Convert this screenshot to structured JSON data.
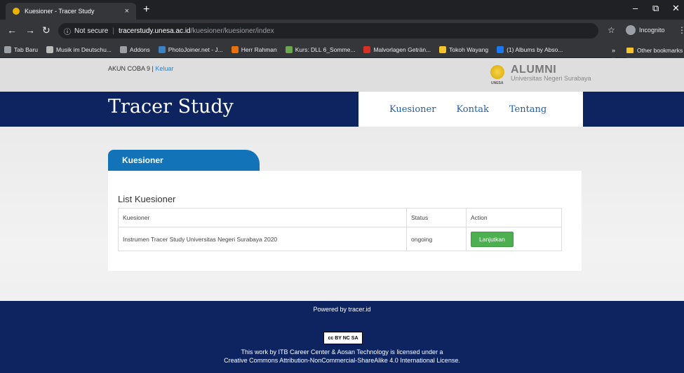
{
  "browser": {
    "tab_title": "Kuesioner - Tracer Study",
    "tab_close": "×",
    "new_tab": "+",
    "not_secure": "Not secure",
    "url_host": "tracerstudy.unesa.ac.id",
    "url_path": "/kuesioner/kuesioner/index",
    "incognito": "Incognito",
    "bookmarks": [
      {
        "label": "Tab Baru",
        "color": "#9aa0a6"
      },
      {
        "label": "Musik im Deutschu...",
        "color": "#bbbbbb"
      },
      {
        "label": "Addons",
        "color": "#9aa0a6"
      },
      {
        "label": "PhotoJoiner.net - J...",
        "color": "#3b82c4"
      },
      {
        "label": "Herr Rahman",
        "color": "#e8710a"
      },
      {
        "label": "Kurs: DLL 6_Somme...",
        "color": "#6aa84f"
      },
      {
        "label": "Malvorlagen Geträn...",
        "color": "#d93025"
      },
      {
        "label": "Tokoh Wayang",
        "color": "#f6c32a"
      },
      {
        "label": "(1) Albums by Abso...",
        "color": "#1877f2"
      }
    ],
    "more": "»",
    "other_bookmarks": "Other bookmarks"
  },
  "header": {
    "user": "AKUN COBA 9",
    "separator": " | ",
    "logout": "Keluar",
    "logo_big": "ALUMNI",
    "logo_small": "Universitas Negeri Surabaya",
    "logo_emblem_text": "UNESA"
  },
  "banner": {
    "title": "Tracer Study",
    "nav": [
      "Kuesioner",
      "Kontak",
      "Tentang"
    ]
  },
  "main": {
    "tab_label": "Kuesioner",
    "list_title": "List Kuesioner",
    "columns": [
      "Kuesioner",
      "Status",
      "Action"
    ],
    "rows": [
      {
        "name": "Instrumen Tracer Study Universitas Negeri Surabaya 2020",
        "status": "ongoing",
        "action": "Lanjutkan"
      }
    ]
  },
  "footer": {
    "powered": "Powered by tracer.id",
    "cc_badge": "cc BY NC SA",
    "license_line1": "This work by ITB Career Center & Aosan Technology is licensed under a",
    "license_line2": "Creative Commons Attribution-NonCommercial-ShareAlike 4.0 International License."
  }
}
